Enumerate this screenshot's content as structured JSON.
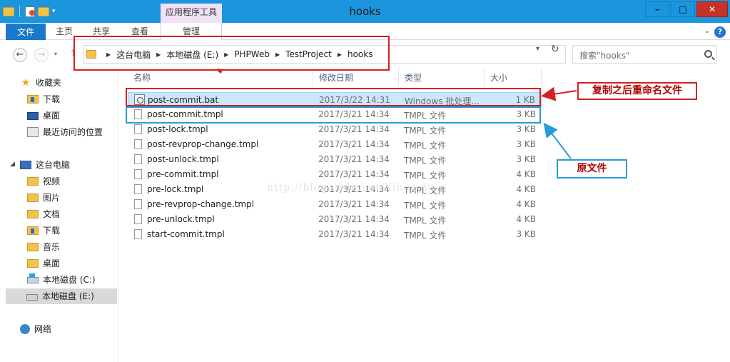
{
  "window": {
    "title": "hooks",
    "contextual_tab": "应用程序工具",
    "controls": {
      "minimize": "–",
      "maximize": "□",
      "close": "✕"
    }
  },
  "ribbon": {
    "tabs": [
      "文件",
      "主页",
      "共享",
      "查看",
      "管理"
    ],
    "active_tab": "文件",
    "help": "?"
  },
  "address": {
    "breadcrumbs": [
      "这台电脑",
      "本地磁盘 (E:)",
      "PHPWeb",
      "TestProject",
      "hooks"
    ],
    "search_placeholder": "搜索\"hooks\""
  },
  "nav_pane": {
    "favorites": {
      "label": "收藏夹",
      "items": [
        "下载",
        "桌面",
        "最近访问的位置"
      ]
    },
    "this_pc": {
      "label": "这台电脑",
      "items": [
        "视频",
        "图片",
        "文档",
        "下载",
        "音乐",
        "桌面",
        "本地磁盘 (C:)",
        "本地磁盘 (E:)"
      ],
      "selected": "本地磁盘 (E:)"
    },
    "network": {
      "label": "网络"
    }
  },
  "file_list": {
    "columns": [
      "名称",
      "修改日期",
      "类型",
      "大小"
    ],
    "files": [
      {
        "name": "post-commit.bat",
        "date": "2017/3/22 14:31",
        "type": "Windows 批处理...",
        "size": "1 KB",
        "selected": true
      },
      {
        "name": "post-commit.tmpl",
        "date": "2017/3/21 14:34",
        "type": "TMPL 文件",
        "size": "3 KB"
      },
      {
        "name": "post-lock.tmpl",
        "date": "2017/3/21 14:34",
        "type": "TMPL 文件",
        "size": "3 KB"
      },
      {
        "name": "post-revprop-change.tmpl",
        "date": "2017/3/21 14:34",
        "type": "TMPL 文件",
        "size": "3 KB"
      },
      {
        "name": "post-unlock.tmpl",
        "date": "2017/3/21 14:34",
        "type": "TMPL 文件",
        "size": "3 KB"
      },
      {
        "name": "pre-commit.tmpl",
        "date": "2017/3/21 14:34",
        "type": "TMPL 文件",
        "size": "4 KB"
      },
      {
        "name": "pre-lock.tmpl",
        "date": "2017/3/21 14:34",
        "type": "TMPL 文件",
        "size": "4 KB"
      },
      {
        "name": "pre-revprop-change.tmpl",
        "date": "2017/3/21 14:34",
        "type": "TMPL 文件",
        "size": "4 KB"
      },
      {
        "name": "pre-unlock.tmpl",
        "date": "2017/3/21 14:34",
        "type": "TMPL 文件",
        "size": "4 KB"
      },
      {
        "name": "start-commit.tmpl",
        "date": "2017/3/21 14:34",
        "type": "TMPL 文件",
        "size": "3 KB"
      }
    ]
  },
  "annotations": {
    "copy_label": "复制之后重命名文件",
    "original_label": "原文件",
    "watermark": "http://blog.csdn.net/Xihua_W"
  },
  "colors": {
    "titlebar": "#1b95dd",
    "file_tab": "#1979ca",
    "annotation_red": "#d42020",
    "annotation_blue": "#2a9bd8",
    "selection": "#cce8ff"
  }
}
